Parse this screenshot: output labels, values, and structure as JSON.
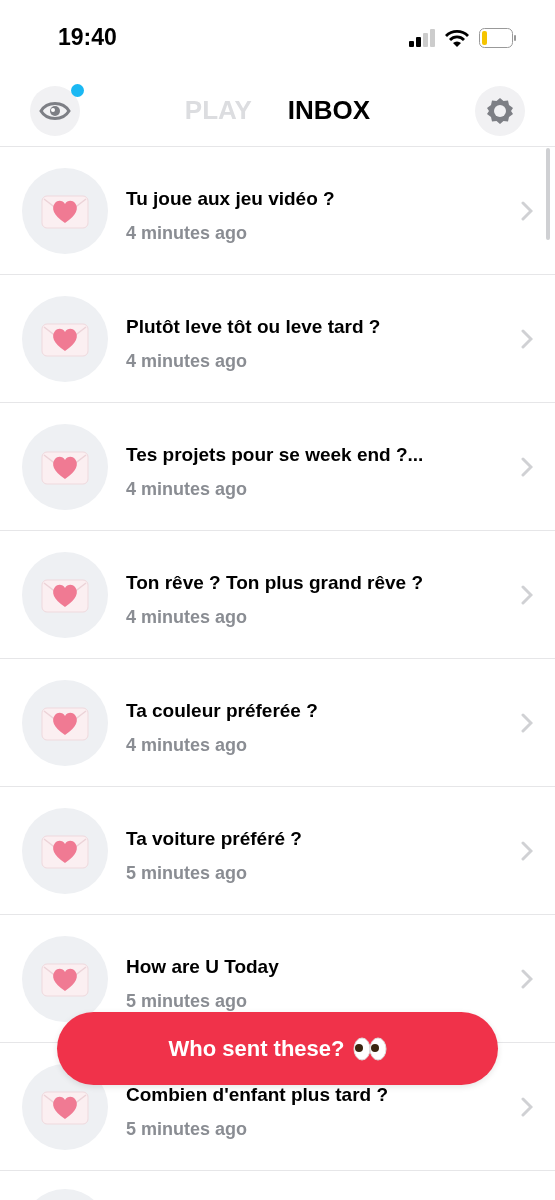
{
  "status_bar": {
    "time": "19:40"
  },
  "header": {
    "eye_button": {
      "unread_dot": true
    },
    "tabs": [
      {
        "label": "PLAY",
        "selected": false
      },
      {
        "label": "INBOX",
        "selected": true
      }
    ]
  },
  "messages": [
    {
      "title": "Tu joue aux jeu vidéo ?",
      "time": "4 minutes ago"
    },
    {
      "title": "Plutôt leve tôt ou leve tard ?",
      "time": "4 minutes ago"
    },
    {
      "title": "Tes projets pour se week end ?...",
      "time": "4 minutes ago"
    },
    {
      "title": "Ton rêve ? Ton plus grand rêve ?",
      "time": "4 minutes ago"
    },
    {
      "title": "Ta couleur préferée ?",
      "time": "4 minutes ago"
    },
    {
      "title": "Ta voiture préféré ?",
      "time": "5 minutes ago"
    },
    {
      "title": "How are U Today",
      "time": "5 minutes ago"
    },
    {
      "title": "Combien d'enfant plus tard ?",
      "time": "5 minutes ago"
    }
  ],
  "more_below": true,
  "action_button": {
    "label": "Who sent these?"
  }
}
